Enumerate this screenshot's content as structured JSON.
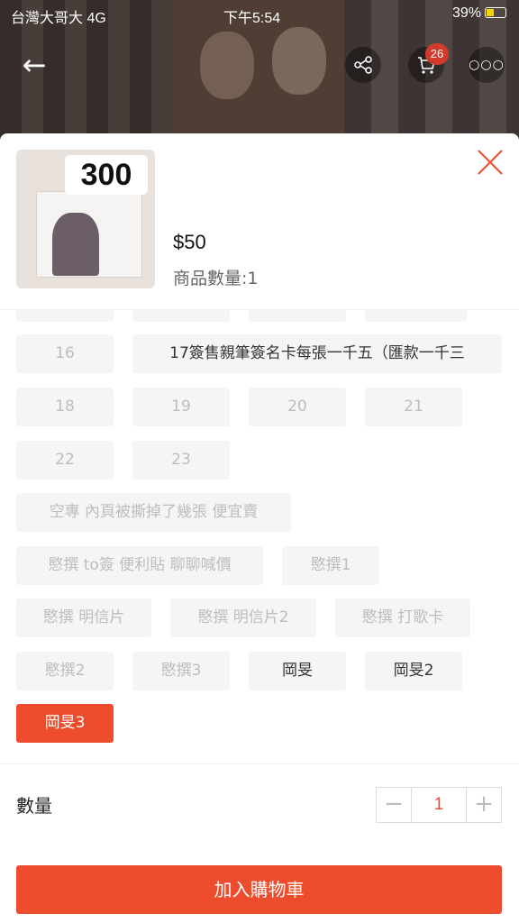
{
  "status_bar": {
    "carrier": "台灣大哥大 4G",
    "time": "下午5:54",
    "battery": "39%"
  },
  "top_nav": {
    "cart_count": "26"
  },
  "product": {
    "thumb_label": "300",
    "price": "$50",
    "quantity_text": "商品數量:1"
  },
  "options": [
    {
      "label": "16"
    },
    {
      "label": "17簽售親筆簽名卡每張一千五（匯款一千三"
    },
    {
      "label": "18"
    },
    {
      "label": "19"
    },
    {
      "label": "20"
    },
    {
      "label": "21"
    },
    {
      "label": "22"
    },
    {
      "label": "23"
    },
    {
      "label": "空專 內頁被撕掉了幾張 便宜賣"
    },
    {
      "label": "愍撰 to簽 便利貼 聊聊喊價"
    },
    {
      "label": "愍撰1"
    },
    {
      "label": "愍撰 明信片"
    },
    {
      "label": "愍撰 明信片2"
    },
    {
      "label": "愍撰 打歌卡"
    },
    {
      "label": "愍撰2"
    },
    {
      "label": "愍撰3"
    },
    {
      "label": "岡旻"
    },
    {
      "label": "岡旻2"
    },
    {
      "label": "岡旻3"
    }
  ],
  "quantity": {
    "label": "數量",
    "value": "1",
    "minus": "−",
    "plus": "+"
  },
  "add_to_cart_label": "加入購物車",
  "colors": {
    "accent": "#ee4d2d",
    "chip_bg": "#f5f5f5",
    "disabled_text": "#bdbdbd"
  }
}
